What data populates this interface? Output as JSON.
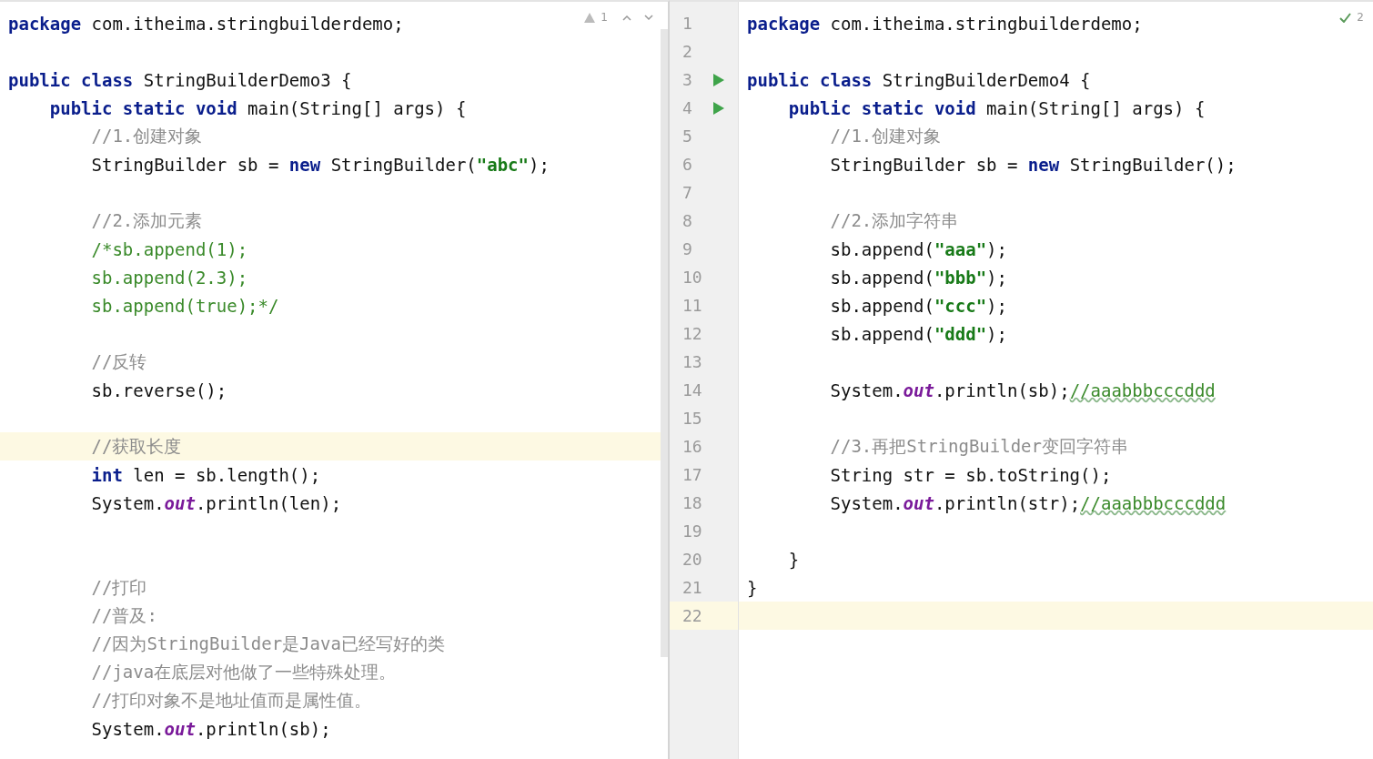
{
  "left_editor": {
    "inspection": {
      "kind": "warning",
      "count": "1"
    },
    "lines": [
      {
        "current": false,
        "tokens": [
          {
            "kind": "kw",
            "text": "package"
          },
          {
            "kind": "plain",
            "text": " com.itheima.stringbuilderdemo;"
          }
        ]
      },
      {
        "current": false
      },
      {
        "current": false,
        "tokens": [
          {
            "kind": "kw",
            "text": "public class"
          },
          {
            "kind": "plain",
            "text": " StringBuilderDemo3 {"
          }
        ]
      },
      {
        "current": false,
        "tokens": [
          {
            "kind": "kw",
            "text": "    public static void"
          },
          {
            "kind": "plain",
            "text": " main(String[] args) {"
          }
        ]
      },
      {
        "current": false,
        "tokens": [
          {
            "kind": "comment",
            "text": "        //1.创建对象"
          }
        ]
      },
      {
        "current": false,
        "tokens": [
          {
            "kind": "plain",
            "text": "        StringBuilder sb = "
          },
          {
            "kind": "kw",
            "text": "new"
          },
          {
            "kind": "plain",
            "text": " StringBuilder("
          },
          {
            "kind": "str",
            "text": "\"abc\""
          },
          {
            "kind": "plain",
            "text": ");"
          }
        ]
      },
      {
        "current": false
      },
      {
        "current": false,
        "tokens": [
          {
            "kind": "comment",
            "text": "        //2.添加元素"
          }
        ]
      },
      {
        "current": false,
        "tokens": [
          {
            "kind": "block",
            "text": "        /*sb.append(1);"
          }
        ]
      },
      {
        "current": false,
        "tokens": [
          {
            "kind": "block",
            "text": "        sb.append(2.3);"
          }
        ]
      },
      {
        "current": false,
        "tokens": [
          {
            "kind": "block",
            "text": "        sb.append(true);*/"
          }
        ]
      },
      {
        "current": false
      },
      {
        "current": false,
        "tokens": [
          {
            "kind": "comment",
            "text": "        //反转"
          }
        ]
      },
      {
        "current": false,
        "tokens": [
          {
            "kind": "plain",
            "text": "        sb.reverse();"
          }
        ]
      },
      {
        "current": false
      },
      {
        "current": true,
        "tokens": [
          {
            "kind": "comment",
            "text": "        //获取长度"
          }
        ]
      },
      {
        "current": false,
        "tokens": [
          {
            "kind": "kw",
            "text": "        int"
          },
          {
            "kind": "plain",
            "text": " len = sb.length();"
          }
        ]
      },
      {
        "current": false,
        "tokens": [
          {
            "kind": "plain",
            "text": "        System."
          },
          {
            "kind": "field",
            "text": "out"
          },
          {
            "kind": "plain",
            "text": ".println(len);"
          }
        ]
      },
      {
        "current": false
      },
      {
        "current": false
      },
      {
        "current": false,
        "tokens": [
          {
            "kind": "comment",
            "text": "        //打印"
          }
        ]
      },
      {
        "current": false,
        "tokens": [
          {
            "kind": "comment",
            "text": "        //普及:"
          }
        ]
      },
      {
        "current": false,
        "tokens": [
          {
            "kind": "comment",
            "text": "        //因为StringBuilder是Java已经写好的类"
          }
        ]
      },
      {
        "current": false,
        "tokens": [
          {
            "kind": "comment",
            "text": "        //java在底层对他做了一些特殊处理。"
          }
        ]
      },
      {
        "current": false,
        "tokens": [
          {
            "kind": "comment",
            "text": "        //打印对象不是地址值而是属性值。"
          }
        ]
      },
      {
        "current": false,
        "tokens": [
          {
            "kind": "plain",
            "text": "        System."
          },
          {
            "kind": "field",
            "text": "out"
          },
          {
            "kind": "plain",
            "text": ".println(sb);"
          }
        ]
      }
    ]
  },
  "right_editor": {
    "inspection": {
      "kind": "ok",
      "count": "2"
    },
    "lines": [
      {
        "number": "1",
        "current": false,
        "run": false,
        "tokens": [
          {
            "kind": "kw",
            "text": "package"
          },
          {
            "kind": "plain",
            "text": " com.itheima.stringbuilderdemo;"
          }
        ]
      },
      {
        "number": "2",
        "current": false,
        "run": false
      },
      {
        "number": "3",
        "current": false,
        "run": true,
        "tokens": [
          {
            "kind": "kw",
            "text": "public class"
          },
          {
            "kind": "plain",
            "text": " StringBuilderDemo4 {"
          }
        ]
      },
      {
        "number": "4",
        "current": false,
        "run": true,
        "tokens": [
          {
            "kind": "kw",
            "text": "    public static void"
          },
          {
            "kind": "plain",
            "text": " main(String[] args) {"
          }
        ]
      },
      {
        "number": "5",
        "current": false,
        "run": false,
        "tokens": [
          {
            "kind": "comment",
            "text": "        //1.创建对象"
          }
        ]
      },
      {
        "number": "6",
        "current": false,
        "run": false,
        "tokens": [
          {
            "kind": "plain",
            "text": "        StringBuilder sb = "
          },
          {
            "kind": "kw",
            "text": "new"
          },
          {
            "kind": "plain",
            "text": " StringBuilder();"
          }
        ]
      },
      {
        "number": "7",
        "current": false,
        "run": false
      },
      {
        "number": "8",
        "current": false,
        "run": false,
        "tokens": [
          {
            "kind": "comment",
            "text": "        //2.添加字符串"
          }
        ]
      },
      {
        "number": "9",
        "current": false,
        "run": false,
        "tokens": [
          {
            "kind": "plain",
            "text": "        sb.append("
          },
          {
            "kind": "str",
            "text": "\"aaa\""
          },
          {
            "kind": "plain",
            "text": ");"
          }
        ]
      },
      {
        "number": "10",
        "current": false,
        "run": false,
        "tokens": [
          {
            "kind": "plain",
            "text": "        sb.append("
          },
          {
            "kind": "str",
            "text": "\"bbb\""
          },
          {
            "kind": "plain",
            "text": ");"
          }
        ]
      },
      {
        "number": "11",
        "current": false,
        "run": false,
        "tokens": [
          {
            "kind": "plain",
            "text": "        sb.append("
          },
          {
            "kind": "str",
            "text": "\"ccc\""
          },
          {
            "kind": "plain",
            "text": ");"
          }
        ]
      },
      {
        "number": "12",
        "current": false,
        "run": false,
        "tokens": [
          {
            "kind": "plain",
            "text": "        sb.append("
          },
          {
            "kind": "str",
            "text": "\"ddd\""
          },
          {
            "kind": "plain",
            "text": ");"
          }
        ]
      },
      {
        "number": "13",
        "current": false,
        "run": false
      },
      {
        "number": "14",
        "current": false,
        "run": false,
        "tokens": [
          {
            "kind": "plain",
            "text": "        System."
          },
          {
            "kind": "field",
            "text": "out"
          },
          {
            "kind": "plain",
            "text": ".println(sb);"
          },
          {
            "kind": "typo",
            "text": "//aaabbbcccddd"
          }
        ]
      },
      {
        "number": "15",
        "current": false,
        "run": false
      },
      {
        "number": "16",
        "current": false,
        "run": false,
        "tokens": [
          {
            "kind": "comment",
            "text": "        //3.再把StringBuilder变回字符串"
          }
        ]
      },
      {
        "number": "17",
        "current": false,
        "run": false,
        "tokens": [
          {
            "kind": "plain",
            "text": "        String str = sb.toString();"
          }
        ]
      },
      {
        "number": "18",
        "current": false,
        "run": false,
        "tokens": [
          {
            "kind": "plain",
            "text": "        System."
          },
          {
            "kind": "field",
            "text": "out"
          },
          {
            "kind": "plain",
            "text": ".println(str);"
          },
          {
            "kind": "typo",
            "text": "//aaabbbcccddd"
          }
        ]
      },
      {
        "number": "19",
        "current": false,
        "run": false
      },
      {
        "number": "20",
        "current": false,
        "run": false,
        "tokens": [
          {
            "kind": "plain",
            "text": "    }"
          }
        ]
      },
      {
        "number": "21",
        "current": false,
        "run": false,
        "tokens": [
          {
            "kind": "plain",
            "text": "}"
          }
        ]
      },
      {
        "number": "22",
        "current": true,
        "run": false
      }
    ]
  }
}
